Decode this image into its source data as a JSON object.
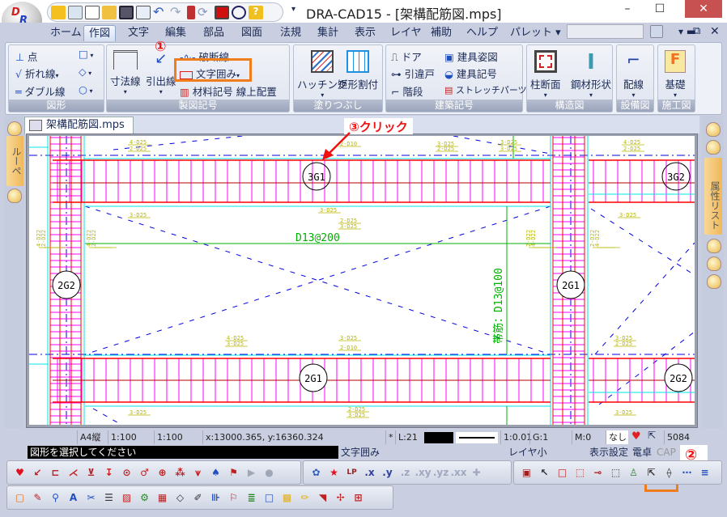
{
  "app": {
    "title": "DRA-CAD15 - [架構配筋図.mps]",
    "logo_text": "DRA"
  },
  "window_controls": {
    "minimize": "–",
    "maximize": "☐",
    "close": "✕"
  },
  "menu": {
    "tabs": [
      "ホーム",
      "作図",
      "文字",
      "編集",
      "部品",
      "図面",
      "法規",
      "集計",
      "表示",
      "レイヤ",
      "補助",
      "ヘルプ",
      "パレット ▾"
    ],
    "active": "作図",
    "search_value": ""
  },
  "ribbon": {
    "groups": [
      {
        "label": "図形",
        "items": [
          "点",
          "折れ線",
          "ダブル線"
        ]
      },
      {
        "label": "製図記号",
        "items": [
          "寸法線",
          "引出線",
          "破断線",
          "文字囲み",
          "材料記号 線上配置"
        ]
      },
      {
        "label": "塗りつぶし",
        "items": [
          "ハッチング",
          "矩形割付"
        ]
      },
      {
        "label": "建築記号",
        "items": [
          "ドア",
          "引違戸",
          "階段",
          "建具姿図",
          "建具記号",
          "ストレッチパーツ"
        ]
      },
      {
        "label": "構造図",
        "items": [
          "柱断面",
          "鋼材形状"
        ]
      },
      {
        "label": "設備図",
        "items": [
          "配線"
        ]
      },
      {
        "label": "施工図",
        "items": [
          "基礎"
        ]
      }
    ]
  },
  "annotations": {
    "step1": "①",
    "step2": "②",
    "step3": "③クリック",
    "highlight_color": "#f07c1c",
    "text_color": "#f01010"
  },
  "document_tab": {
    "label": "架構配筋図.mps",
    "close": "×"
  },
  "left_panel": {
    "tab": "ルーペ"
  },
  "right_panel": {
    "tab": "属性リスト"
  },
  "drawing": {
    "beam_marks": [
      "3G1",
      "3G2",
      "2G2",
      "2G1",
      "2G1",
      "2G2"
    ],
    "labels": {
      "slab_bar": "D13@200",
      "hoop": "帯筋：D13@100"
    },
    "rebar_notes": [
      "4-D25",
      "2-D25",
      "2-D10",
      "3-D25",
      "3-D25",
      "2-D25",
      "3-D25",
      "3-D25",
      "2-D25",
      "3-D25",
      "3-D25",
      "4-D22",
      "2-D22",
      "2-D22",
      "4-D22",
      "2-D22",
      "4-D22",
      "4-D22",
      "2-D22",
      "4-D25",
      "3-D25",
      "3-D25",
      "2-D10",
      "3-D25",
      "2-D25",
      "3-D25",
      "2-D25",
      "3-D25",
      "3-D25",
      "4-D25",
      "2-D25",
      "3-D25"
    ],
    "colors": {
      "beam": "#ff0000",
      "stirrup": "#ff00ff",
      "outline": "#00e5e5",
      "center": "#0000e0",
      "note": "#b8b800",
      "text": "#00b000"
    }
  },
  "status_bar": {
    "paper": "A4縦",
    "scale1": "1:100",
    "scale2": "1:100",
    "coords": "x:13000.365, y:16360.324",
    "star": "*",
    "layer": "L:21",
    "ratio": "1:0.01",
    "group": "G:1",
    "mode": "M:0",
    "none": "なし",
    "count": "5084"
  },
  "message_bar": {
    "prompt": "図形を選択してください",
    "command": "文字囲み",
    "layer_size": "レイヤ小",
    "display_settings": "表示設定",
    "calculator": "電卓",
    "cap": "CAP"
  },
  "toolbar1": {
    "axis_buttons": [
      ".x",
      ".y",
      ".z",
      ".xy",
      ".yz",
      ".xx"
    ],
    "lp": "LP"
  }
}
